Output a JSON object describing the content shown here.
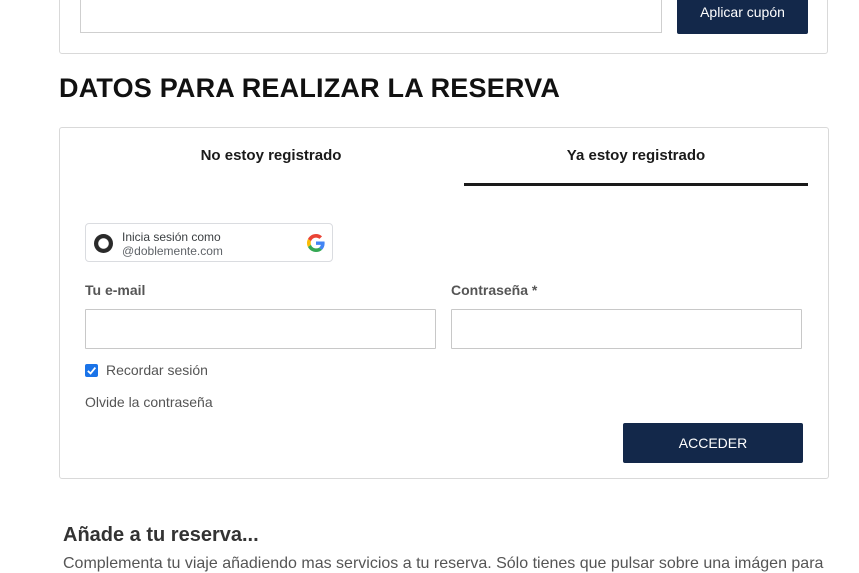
{
  "coupon": {
    "input_value": "",
    "button_label": "Aplicar cupón"
  },
  "reservation": {
    "title": "DATOS PARA REALIZAR LA RESERVA",
    "tabs": [
      {
        "label": "No estoy registrado",
        "active": false
      },
      {
        "label": "Ya estoy registrado",
        "active": true
      }
    ]
  },
  "google_signin": {
    "line1": "Inicia sesión como",
    "line2": "@doblemente.com",
    "icon": "google-g-icon"
  },
  "login_form": {
    "email_label": "Tu e-mail",
    "email_value": "",
    "password_label": "Contraseña *",
    "password_value": "",
    "remember_label": "Recordar sesión",
    "remember_checked": true,
    "forgot_label": "Olvide la contraseña",
    "submit_label": "ACCEDER"
  },
  "addons": {
    "title": "Añade a tu reserva...",
    "description": "Complementa tu viaje añadiendo mas servicios a tu reserva. Sólo tienes que pulsar sobre una imágen para"
  },
  "colors": {
    "primary": "#13284a",
    "checkbox": "#1a73e8",
    "border": "#d9d9d9"
  }
}
